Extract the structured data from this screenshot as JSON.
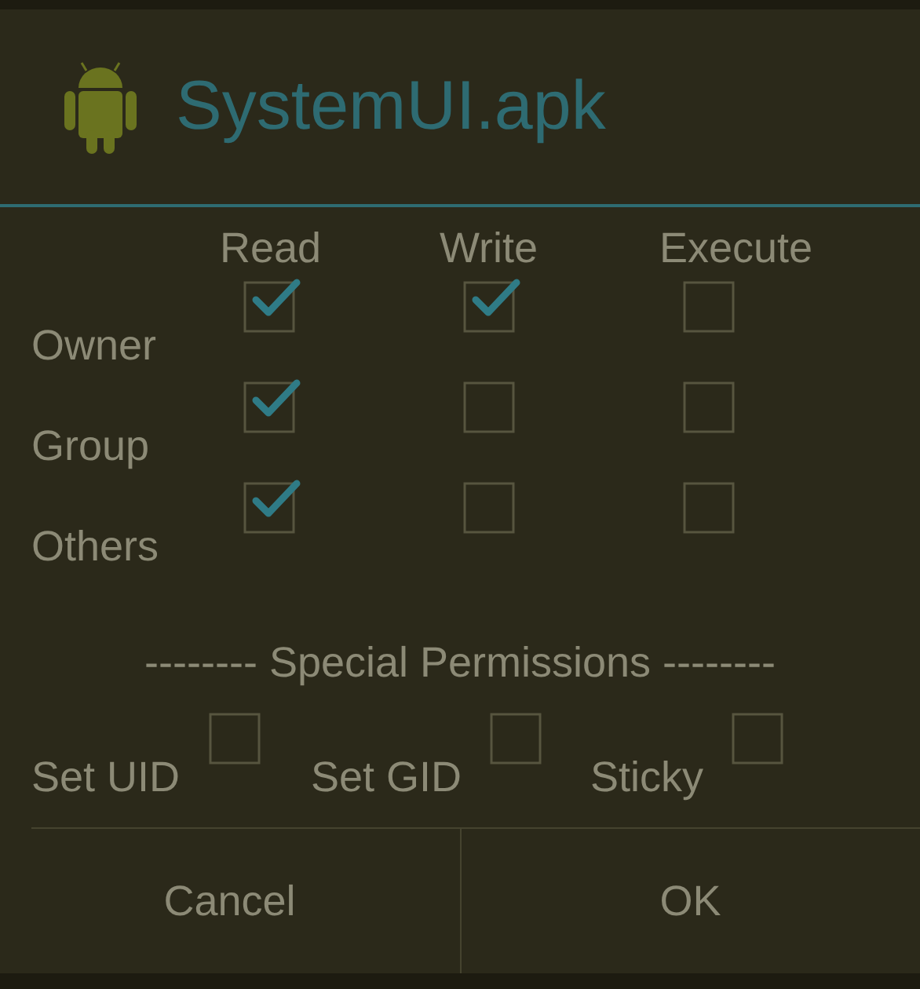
{
  "dialog": {
    "title": "SystemUI.apk"
  },
  "columns": [
    "Read",
    "Write",
    "Execute"
  ],
  "rows": [
    {
      "label": "Owner",
      "checks": [
        {
          "checked": true
        },
        {
          "checked": true
        },
        {
          "checked": false
        }
      ]
    },
    {
      "label": "Group",
      "checks": [
        {
          "checked": true
        },
        {
          "checked": false
        },
        {
          "checked": false
        }
      ]
    },
    {
      "label": "Others",
      "checks": [
        {
          "checked": true
        },
        {
          "checked": false
        },
        {
          "checked": false
        }
      ]
    }
  ],
  "special_heading": "-------- Special Permissions --------",
  "special": [
    {
      "label": "Set UID",
      "checked": false
    },
    {
      "label": "Set GID",
      "checked": false
    },
    {
      "label": "Sticky",
      "checked": false
    }
  ],
  "buttons": [
    "Cancel",
    "OK"
  ]
}
